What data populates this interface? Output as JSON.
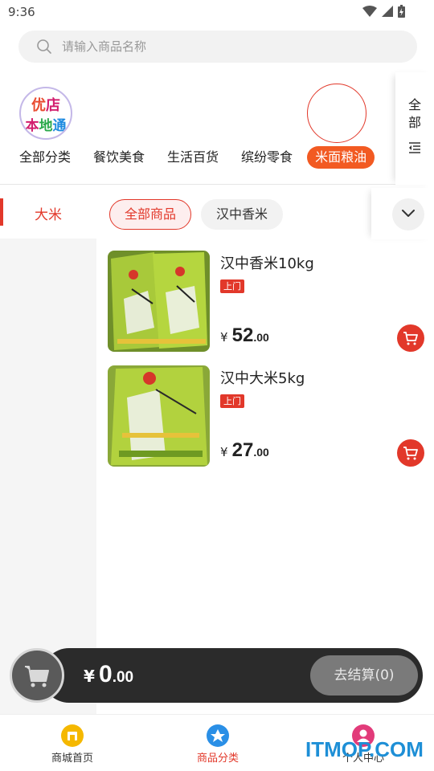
{
  "status_bar": {
    "time": "9:36"
  },
  "search": {
    "placeholder": "请输入商品名称"
  },
  "logo": {
    "line1": [
      "优",
      "店"
    ],
    "line2": [
      "本",
      "地",
      "通"
    ]
  },
  "categories": [
    "全部分类",
    "餐饮美食",
    "生活百货",
    "缤纷零食",
    "米面粮油"
  ],
  "categories_active_index": 4,
  "all_side": {
    "label": "全部"
  },
  "left_menu": {
    "active_label": "大米"
  },
  "sub_tabs": [
    "全部商品",
    "汉中香米"
  ],
  "sub_tabs_active_index": 0,
  "products": [
    {
      "name": "汉中香米10kg",
      "tag": "上门",
      "currency": "¥",
      "price_int": "52",
      "price_dec": ".00"
    },
    {
      "name": "汉中大米5kg",
      "tag": "上门",
      "currency": "¥",
      "price_int": "27",
      "price_dec": ".00"
    }
  ],
  "cart": {
    "currency": "¥",
    "total_int": "0",
    "total_dec": ".00",
    "checkout_label": "去结算(0)"
  },
  "bottom_nav": [
    {
      "label": "商城首页",
      "icon": "store-icon",
      "color": "#f5b800"
    },
    {
      "label": "商品分类",
      "icon": "category-icon",
      "color": "#2a8fe6"
    },
    {
      "label": "个人中心",
      "icon": "user-icon",
      "color": "#e23b7a"
    }
  ],
  "bottom_nav_active_index": 1,
  "watermark": "ITMOP.COM",
  "colors": {
    "accent": "#e2382a",
    "active_category": "#f25a22"
  }
}
